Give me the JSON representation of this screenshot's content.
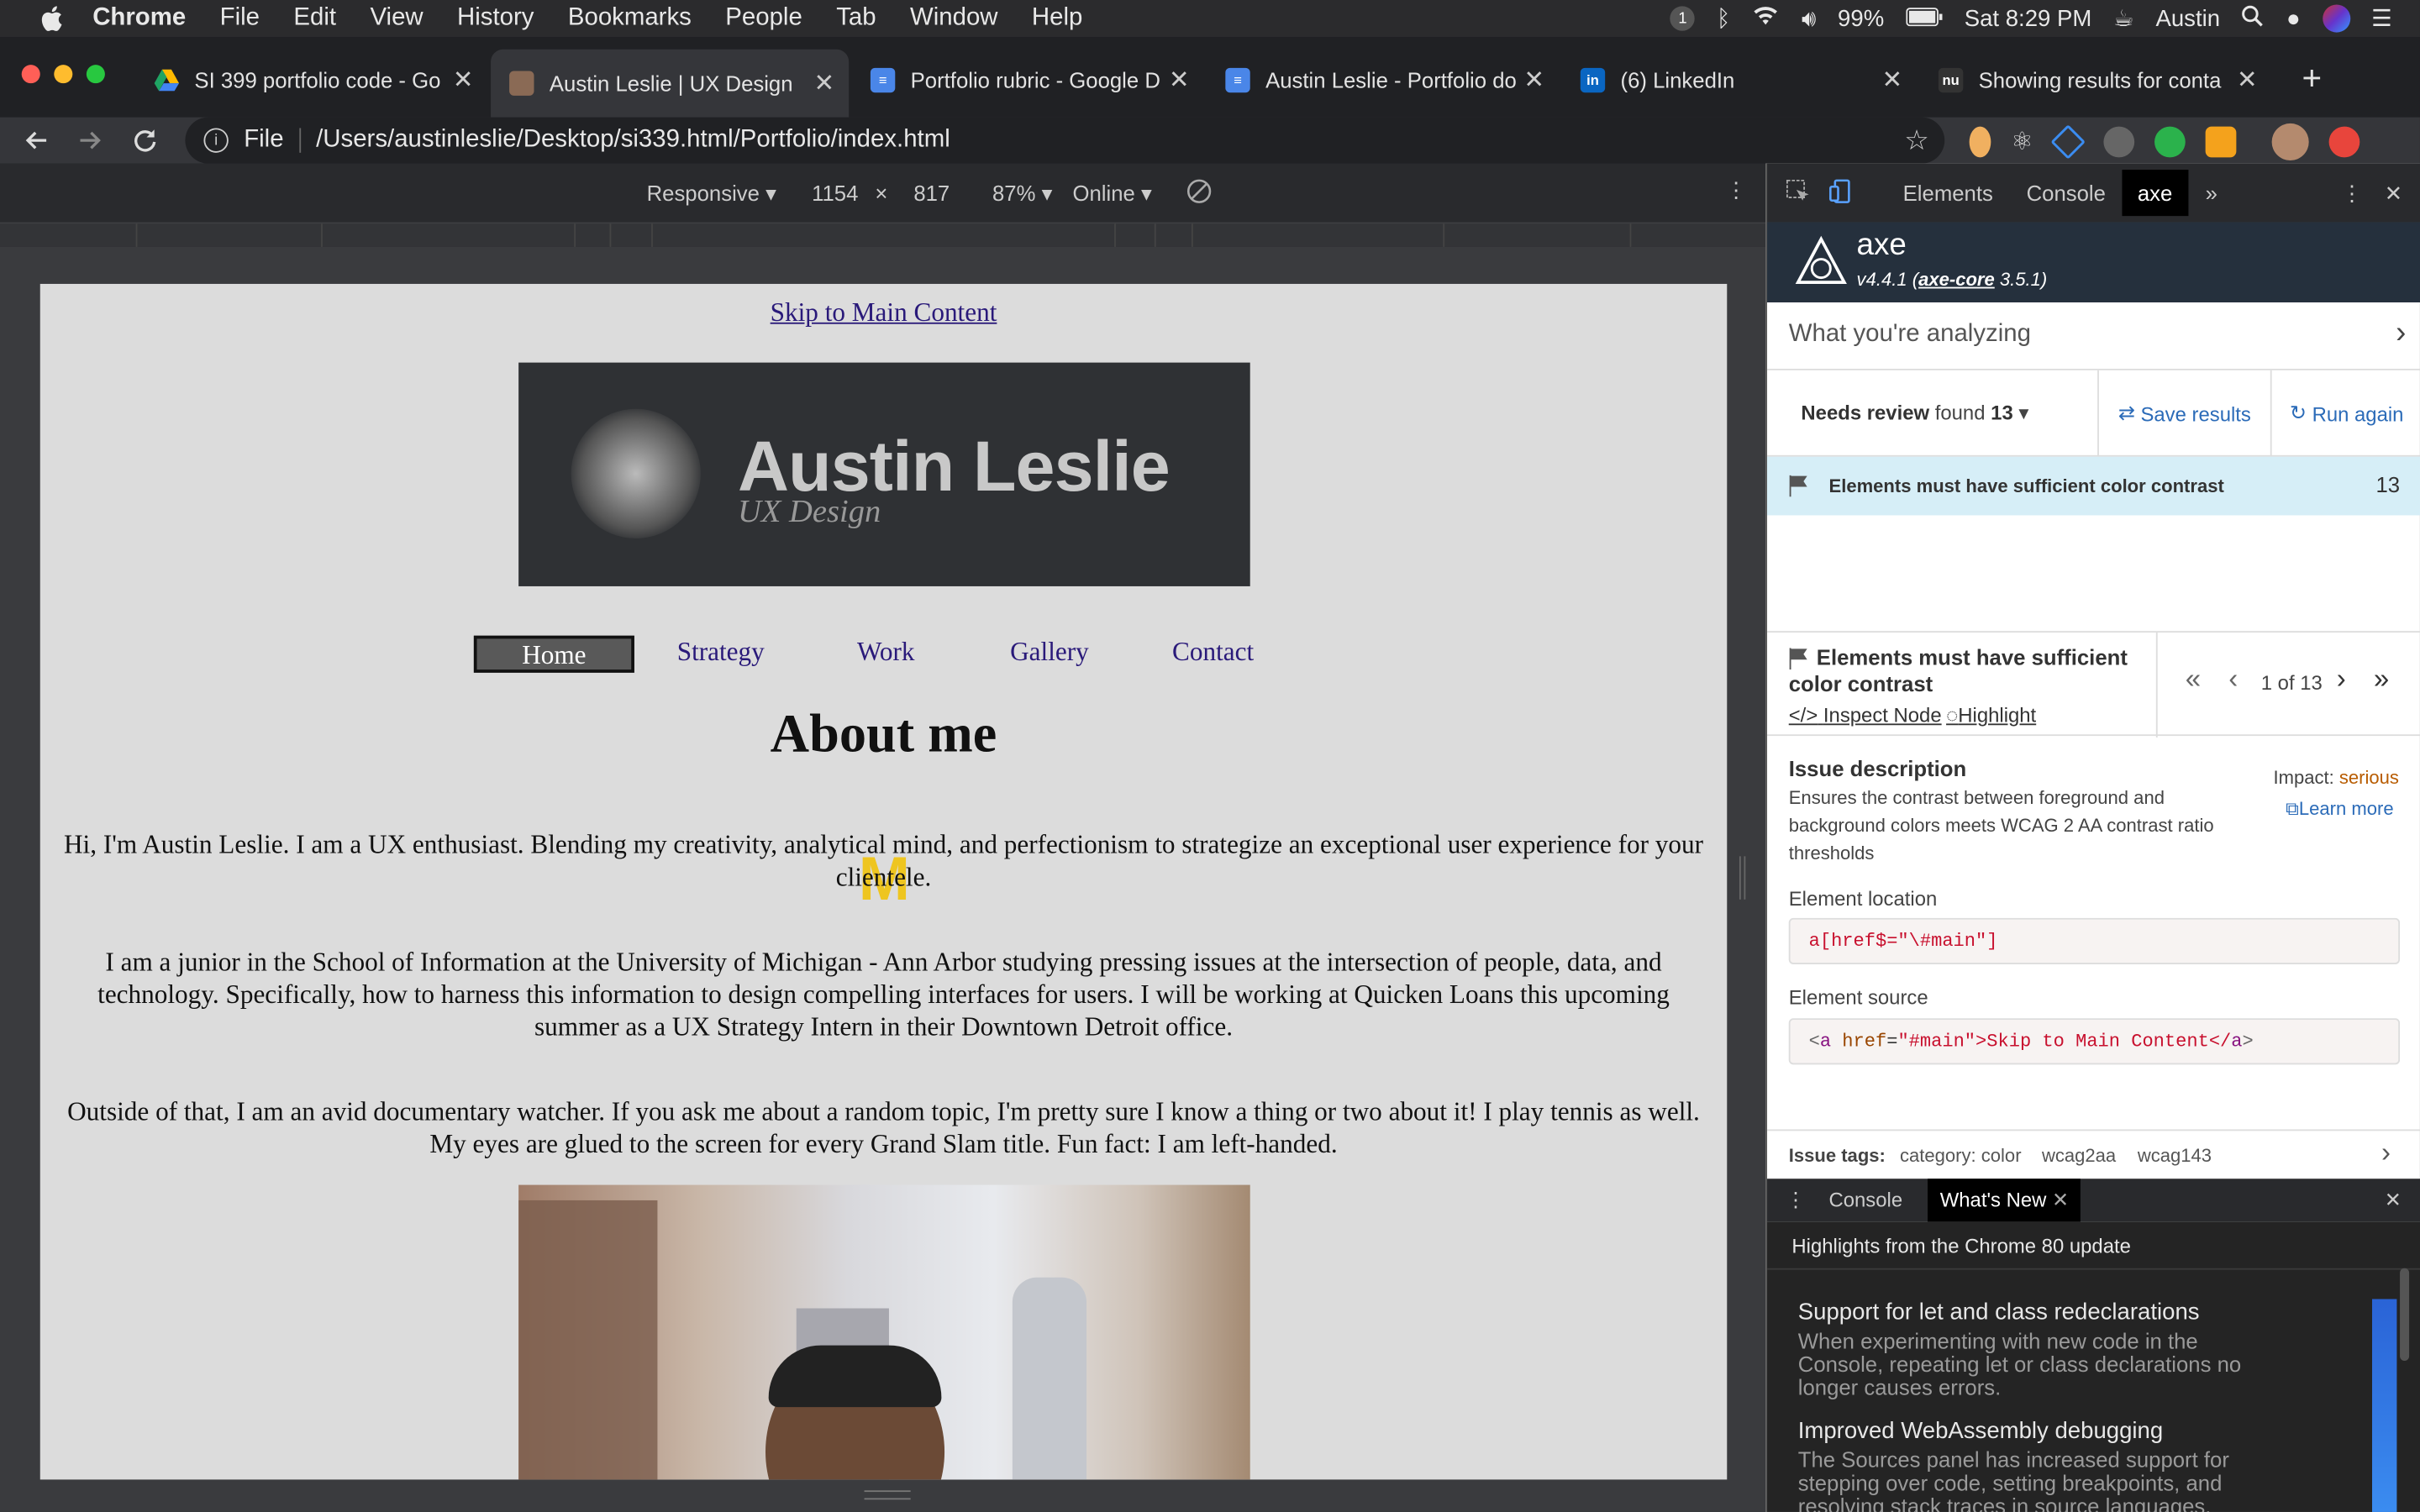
{
  "menubar": {
    "app": "Chrome",
    "items": [
      "File",
      "Edit",
      "View",
      "History",
      "Bookmarks",
      "People",
      "Tab",
      "Window",
      "Help"
    ],
    "notif_count": "1",
    "battery": "99%",
    "datetime": "Sat 8:29 PM",
    "user": "Austin"
  },
  "tabs": [
    {
      "title": "SI 399 portfolio code - Go",
      "favicon": "drive-icon",
      "color": "#1fa463"
    },
    {
      "title": "Austin Leslie | UX Design",
      "favicon": "portrait-icon",
      "color": "#8a6a55",
      "active": true
    },
    {
      "title": "Portfolio rubric - Google D",
      "favicon": "docs-icon",
      "color": "#4a86e8"
    },
    {
      "title": "Austin Leslie - Portfolio do",
      "favicon": "docs-icon",
      "color": "#4a86e8"
    },
    {
      "title": "(6) LinkedIn",
      "favicon": "linkedin-icon",
      "color": "#0a66c2"
    },
    {
      "title": "Showing results for conta",
      "favicon": "nu-icon",
      "color": "#333"
    }
  ],
  "omnibox": {
    "scheme": "File",
    "url": "/Users/austinleslie/Desktop/si339.html/Portfolio/index.html"
  },
  "device_toolbar": {
    "mode": "Responsive",
    "width": "1154",
    "times": "×",
    "height": "817",
    "zoom": "87%",
    "network": "Online"
  },
  "page": {
    "skip_link": "Skip to Main Content",
    "banner_name": "Austin Leslie",
    "banner_sub": "UX Design",
    "nav": [
      "Home",
      "Strategy",
      "Work",
      "Gallery",
      "Contact"
    ],
    "heading": "About me",
    "p1": "Hi, I'm Austin Leslie. I am a UX enthusiast. Blending my creativity, analytical mind, and perfectionism to strategize an exceptional user experience for your clientele.",
    "p2": "I am a junior in the School of Information at the University of Michigan - Ann Arbor studying pressing issues at the intersection of people, data, and technology. Specifically, how to harness this information to design compelling interfaces for users. I will be working at Quicken Loans this upcoming summer as a UX Strategy Intern in their Downtown Detroit office.",
    "p3": "Outside of that, I am an avid documentary watcher. If you ask me about a random topic, I'm pretty sure I know a thing or two about it! I play tennis as well. My eyes are glued to the screen for every Grand Slam title. Fun fact: I am left-handed.",
    "m_logo": "M"
  },
  "devtools": {
    "tabs": [
      "Elements",
      "Console",
      "axe"
    ],
    "more": "»",
    "axe_name": "axe",
    "axe_version": "v4.4.1 (",
    "axe_core_link": "axe-core",
    "axe_core_version": " 3.5.1)",
    "analyzing": "What you're analyzing",
    "needs_review": "Needs review",
    "found": "found",
    "found_count": "13",
    "save_results": "Save results",
    "run_again": "Run again",
    "issue_title": "Elements must have sufficient color contrast",
    "issue_count": "13",
    "detail_title": "Elements must have sufficient color contrast",
    "inspect_node": "Inspect Node",
    "highlight": "Highlight",
    "pager_text": "1 of 13",
    "desc_title": "Issue description",
    "desc_text": "Ensures the contrast between foreground and background colors meets WCAG 2 AA contrast ratio thresholds",
    "impact_label": "Impact:",
    "impact_value": "serious",
    "learn_more": "Learn more",
    "location_label": "Element location",
    "location_value": "a[href$=\"\\#main\"]",
    "source_label": "Element source",
    "source_tag_open": "<",
    "source_tag": "a",
    "source_attr": " href",
    "source_eq": "=",
    "source_val": "\"#main\"",
    "source_text": ">Skip to Main Content</",
    "source_tag_close": "a",
    "source_end": ">",
    "tags_label": "Issue tags:",
    "tags": [
      "category: color",
      "wcag2aa",
      "wcag143"
    ],
    "drawer_console": "Console",
    "drawer_whatsnew": "What's New",
    "whatsnew_headline": "Highlights from the Chrome 80 update",
    "wn1_title": "Support for let and class redeclarations",
    "wn1_body": "When experimenting with new code in the Console, repeating let or class declarations no longer causes errors.",
    "wn2_title": "Improved WebAssembly debugging",
    "wn2_body": "The Sources panel has increased support for stepping over code, setting breakpoints, and resolving stack traces in source languages."
  },
  "colors": {
    "axe_header": "#25303d",
    "issue_row": "#d6eef7",
    "link": "#2b6bb8",
    "impact": "#b85c00",
    "nav_link": "#2a1a7a"
  }
}
